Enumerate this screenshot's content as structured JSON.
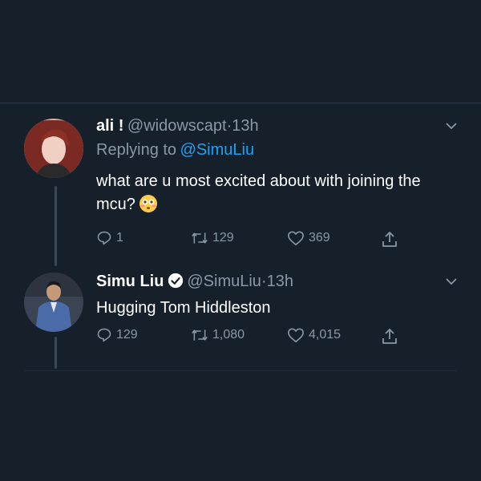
{
  "tweet1": {
    "display_name": "ali !",
    "handle": "@widowscapt",
    "separator": "·",
    "time": "13h",
    "replying_prefix": "Replying to",
    "replying_to": "@SimuLiu",
    "text": "what are u most excited about with joining the mcu?",
    "emoji": "flushed-face",
    "counts": {
      "reply": "1",
      "retweet": "129",
      "like": "369"
    }
  },
  "tweet2": {
    "display_name": "Simu Liu",
    "verified": true,
    "handle": "@SimuLiu",
    "separator": "·",
    "time": "13h",
    "text": "Hugging Tom Hiddleston",
    "counts": {
      "reply": "129",
      "retweet": "1,080",
      "like": "4,015"
    }
  },
  "colors": {
    "background": "#15202b",
    "text": "#ffffff",
    "muted": "#8899a6",
    "link": "#1da1f2"
  }
}
